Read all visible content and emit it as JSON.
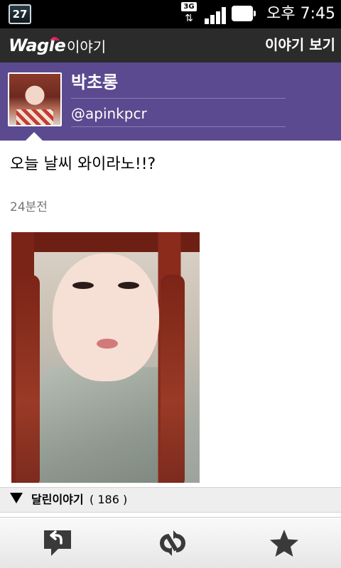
{
  "status_bar": {
    "calendar_day": "27",
    "network_type": "3G",
    "network_arrows": "⇅",
    "time": "오후 7:45",
    "icons": {
      "calendar": "calendar-icon",
      "signal": "signal-icon",
      "battery": "battery-icon"
    }
  },
  "app_bar": {
    "logo_wordmark": "Wagle",
    "logo_sub": "이야기",
    "view_story_label": "이야기 보기",
    "colors": {
      "background": "#2b2b2b",
      "logo_wave": "#e0225a"
    }
  },
  "profile": {
    "display_name": "박초롱",
    "handle": "@apinkpcr",
    "colors": {
      "header_background": "#5b4a8f"
    }
  },
  "post": {
    "text": "오늘 날씨 와이라노!!?",
    "time_ago": "24분전"
  },
  "replies": {
    "label": "달린이야기",
    "count_display": "( 186 )"
  },
  "toolbar": {
    "buttons": [
      {
        "name": "reply-button",
        "icon": "reply-icon"
      },
      {
        "name": "retweet-button",
        "icon": "retweet-icon"
      },
      {
        "name": "favorite-button",
        "icon": "star-icon"
      }
    ]
  }
}
